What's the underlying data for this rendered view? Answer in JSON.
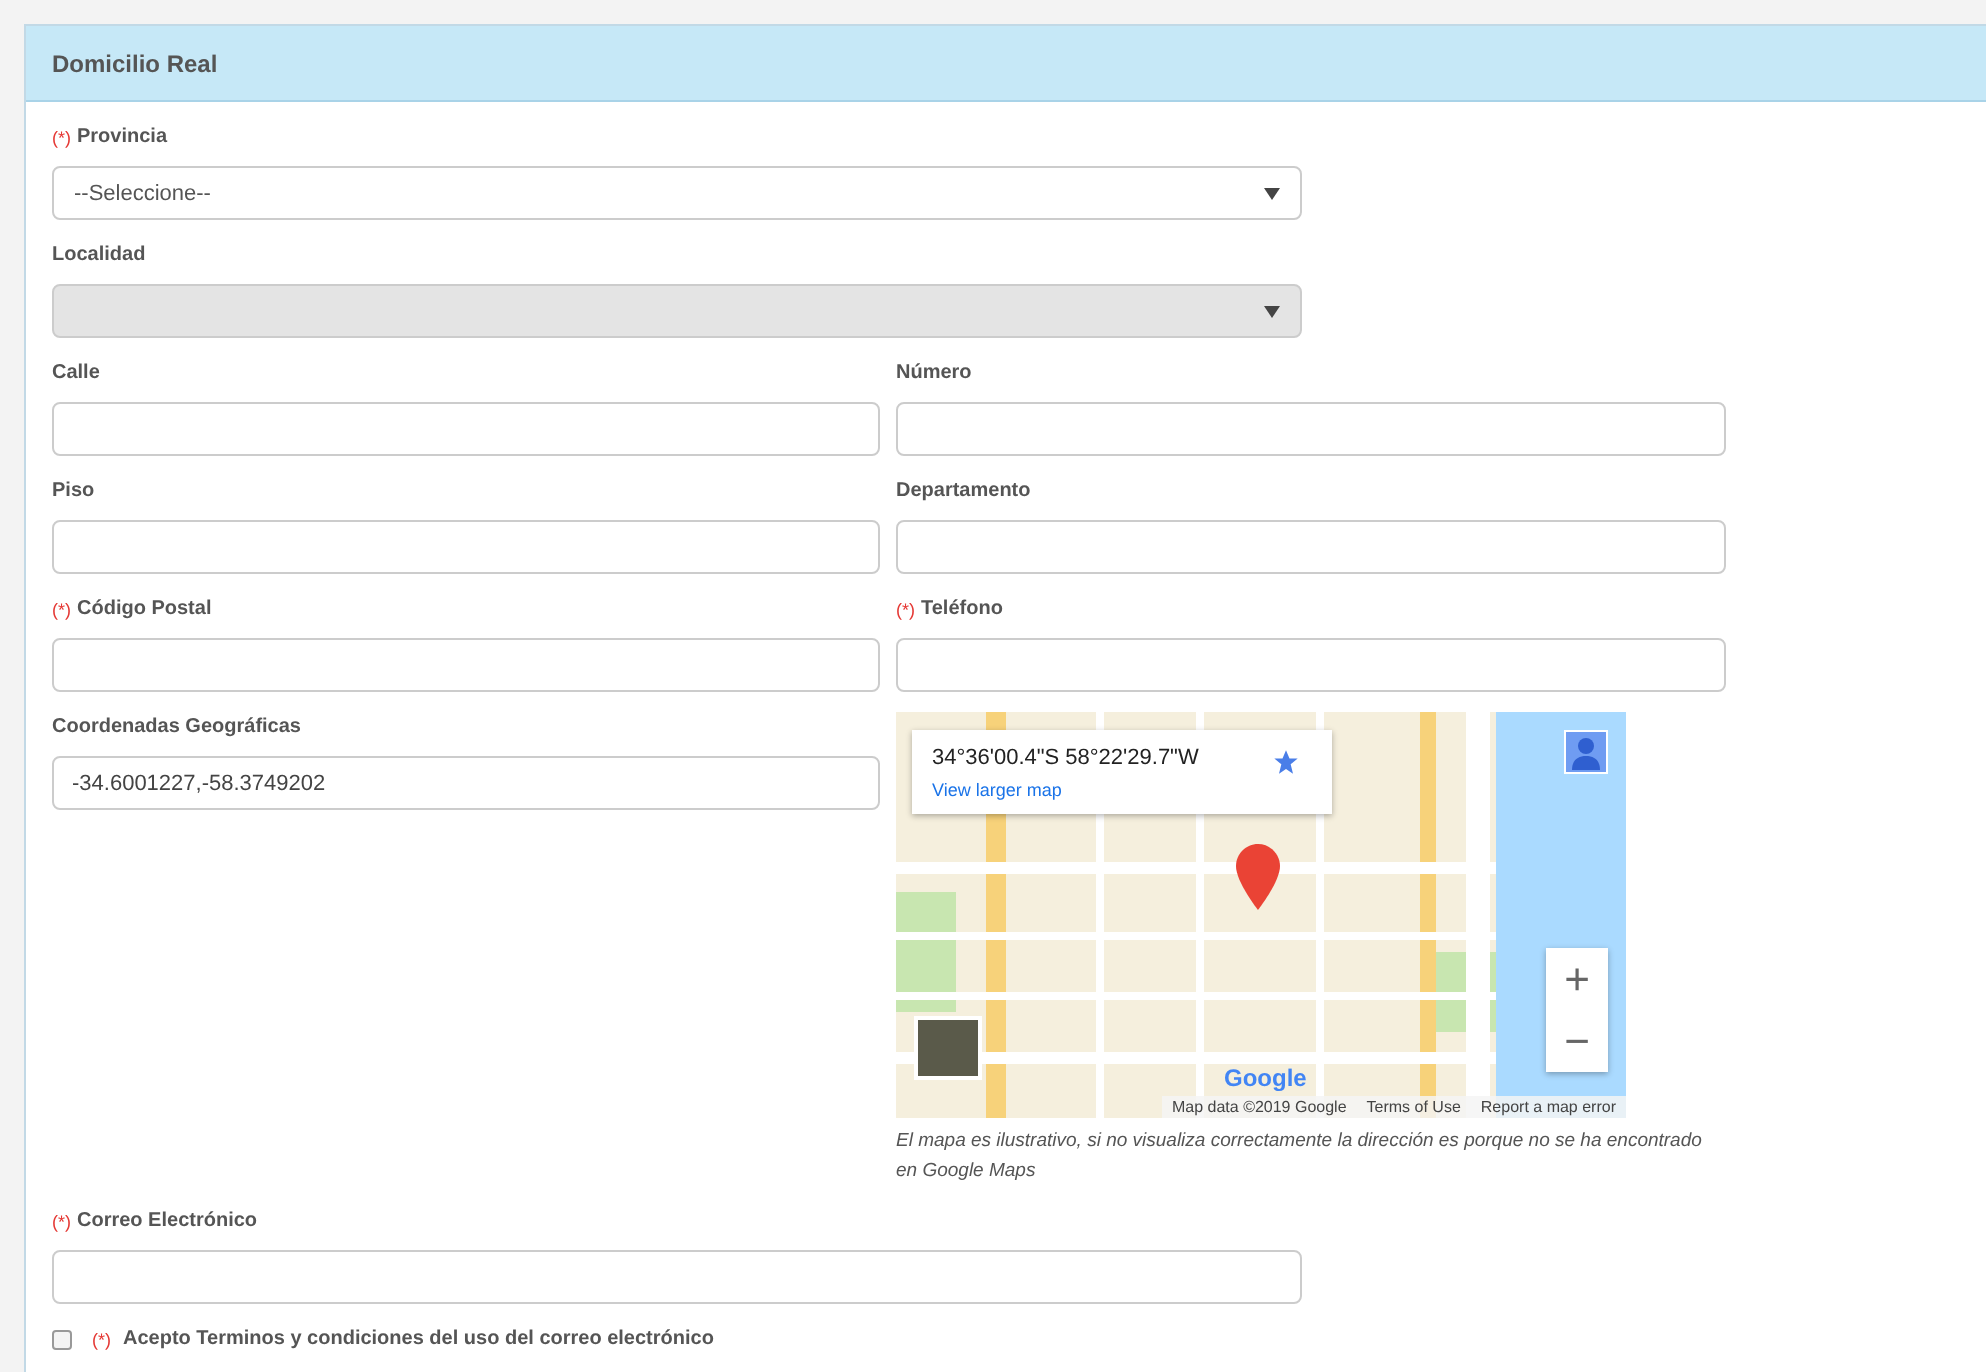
{
  "panel": {
    "title": "Domicilio Real"
  },
  "rows": [
    {
      "fields": [
        {
          "kind": "select",
          "mark": "(*)",
          "label": "Provincia",
          "value": "--Seleccione--",
          "disabled": false,
          "wide": true
        }
      ]
    },
    {
      "fields": [
        {
          "kind": "select",
          "label": "Localidad",
          "disabled": true,
          "wide": true
        }
      ]
    },
    {
      "fields": [
        {
          "kind": "text",
          "label": "Calle"
        },
        {
          "kind": "text",
          "label": "Número"
        }
      ]
    },
    {
      "fields": [
        {
          "kind": "text",
          "label": "Piso"
        },
        {
          "kind": "text",
          "label": "Departamento"
        }
      ]
    },
    {
      "fields": [
        {
          "kind": "text",
          "mark": "(*)",
          "label": "Código Postal"
        },
        {
          "kind": "text",
          "mark": "(*)",
          "label": "Teléfono"
        }
      ]
    },
    {
      "fields": [
        {
          "kind": "text",
          "label": "Coordenadas Geográficas",
          "value": "-34.6001227,-58.3749202"
        },
        {
          "kind": "map",
          "coords": "34°36'00.4\"S 58°22'29.7\"W",
          "link": "View larger map",
          "zoom_in": "+",
          "zoom_out": "−",
          "logo": "Google",
          "attribution": [
            "Map data ©2019 Google",
            "Terms of Use",
            "Report a map error"
          ],
          "note": "El mapa es ilustrativo, si no visualiza correctamente la dirección es porque no se ha encontrado en Google Maps"
        }
      ]
    },
    {
      "fields": [
        {
          "kind": "text",
          "mark": "(*)",
          "label": "Correo Electrónico",
          "wide": true
        }
      ]
    }
  ],
  "terms": {
    "checked": false,
    "mark": "(*)",
    "label": "Acepto Terminos y condiciones del uso del correo electrónico"
  }
}
